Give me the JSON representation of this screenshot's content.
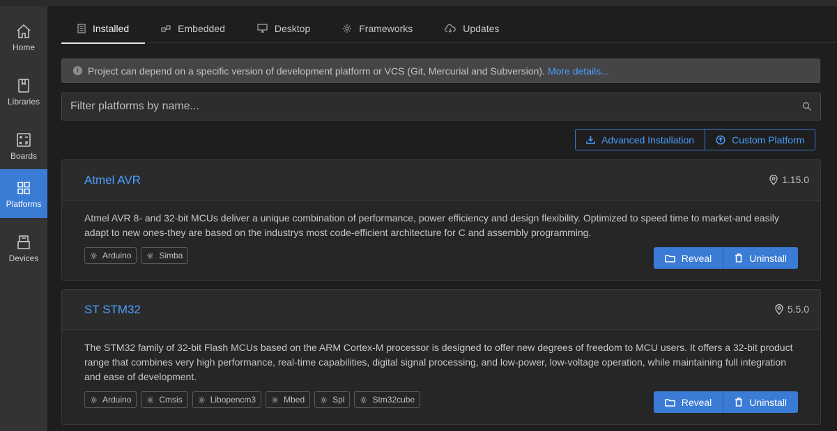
{
  "sidebar": {
    "items": [
      {
        "label": "Home",
        "icon": "home-icon"
      },
      {
        "label": "Libraries",
        "icon": "book-icon"
      },
      {
        "label": "Boards",
        "icon": "calculator-icon"
      },
      {
        "label": "Platforms",
        "icon": "grid-icon",
        "active": true
      },
      {
        "label": "Devices",
        "icon": "device-icon"
      }
    ]
  },
  "tabs": [
    {
      "label": "Installed",
      "icon": "document-icon",
      "active": true
    },
    {
      "label": "Embedded",
      "icon": "chip-icon"
    },
    {
      "label": "Desktop",
      "icon": "monitor-icon"
    },
    {
      "label": "Frameworks",
      "icon": "gear-icon"
    },
    {
      "label": "Updates",
      "icon": "cloud-download-icon"
    }
  ],
  "notice": {
    "text": "Project can depend on a specific version of development platform or VCS (Git, Mercurial and Subversion).",
    "link": "More details..."
  },
  "filter": {
    "placeholder": "Filter platforms by name...",
    "value": ""
  },
  "actions": {
    "advanced": "Advanced Installation",
    "custom": "Custom Platform"
  },
  "platforms": [
    {
      "name": "Atmel AVR",
      "version": "1.15.0",
      "description": "Atmel AVR 8- and 32-bit MCUs deliver a unique combination of performance, power efficiency and design flexibility. Optimized to speed time to market-and easily adapt to new ones-they are based on the industrys most code-efficient architecture for C and assembly programming.",
      "frameworks": [
        "Arduino",
        "Simba"
      ],
      "reveal": "Reveal",
      "uninstall": "Uninstall"
    },
    {
      "name": "ST STM32",
      "version": "5.5.0",
      "description": "The STM32 family of 32-bit Flash MCUs based on the ARM Cortex-M processor is designed to offer new degrees of freedom to MCU users. It offers a 32-bit product range that combines very high performance, real-time capabilities, digital signal processing, and low-power, low-voltage operation, while maintaining full integration and ease of development.",
      "frameworks": [
        "Arduino",
        "Cmsis",
        "Libopencm3",
        "Mbed",
        "Spl",
        "Stm32cube"
      ],
      "reveal": "Reveal",
      "uninstall": "Uninstall"
    }
  ],
  "colors": {
    "accent": "#3a7bd5",
    "link": "#4a9eff",
    "sidebar_bg": "#333333",
    "main_bg": "#1e1e1e"
  }
}
